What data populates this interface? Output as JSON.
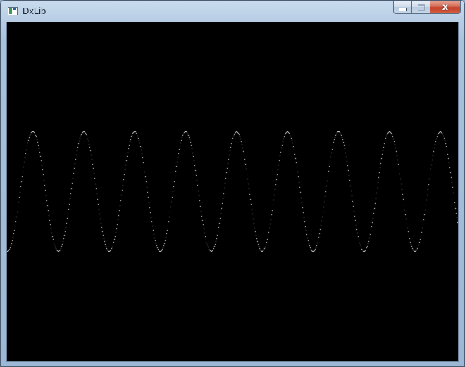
{
  "window": {
    "title": "DxLib",
    "minimize_label": "",
    "maximize_label": "",
    "close_label": "x"
  },
  "canvas": {
    "background": "#000000",
    "wave_color": "#ffffff",
    "chart_data": {
      "type": "line",
      "series": [
        {
          "function": "sine",
          "amplitude": 1,
          "cycles_visible": 8.85,
          "phase_start": "minimum-rising"
        }
      ]
    }
  }
}
